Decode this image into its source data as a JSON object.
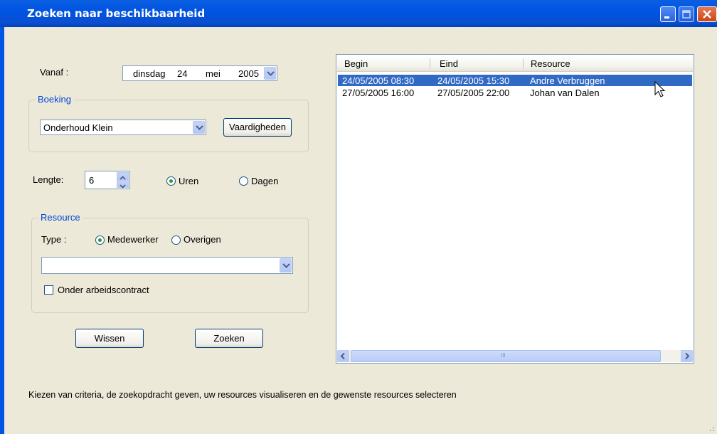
{
  "window": {
    "title": "Zoeken naar beschikbaarheid"
  },
  "vanaf": {
    "label": "Vanaf :",
    "weekday": "dinsdag",
    "day": "24",
    "month": "mei",
    "year": "2005"
  },
  "boeking": {
    "group_title": "Boeking",
    "selected": "Onderhoud Klein",
    "vaardigheden_label": "Vaardigheden"
  },
  "lengte": {
    "label": "Lengte:",
    "value": "6",
    "uren_label": "Uren",
    "dagen_label": "Dagen",
    "selected": "Uren"
  },
  "resource": {
    "group_title": "Resource",
    "type_label": "Type :",
    "medewerker_label": "Medewerker",
    "overigen_label": "Overigen",
    "selected_type": "Medewerker",
    "combo_value": "",
    "contract_label": "Onder arbeidscontract",
    "contract_checked": false
  },
  "buttons": {
    "wissen": "Wissen",
    "zoeken": "Zoeken"
  },
  "results": {
    "columns": [
      "Begin",
      "Eind",
      "Resource"
    ],
    "rows": [
      {
        "begin": "24/05/2005 08:30",
        "eind": "24/05/2005 15:30",
        "resource": "Andre Verbruggen",
        "selected": true
      },
      {
        "begin": "27/05/2005 16:00",
        "eind": "27/05/2005 22:00",
        "resource": "Johan van Dalen",
        "selected": false
      }
    ],
    "scroll_thumb_label": "III"
  },
  "status": {
    "text": "Kiezen van criteria, de zoekopdracht geven, uw resources visualiseren en de gewenste resources selecteren"
  },
  "colors": {
    "title_bar": "#0054e3",
    "selection": "#316ac5",
    "group_title": "#0046d5",
    "background": "#ece9d8"
  }
}
